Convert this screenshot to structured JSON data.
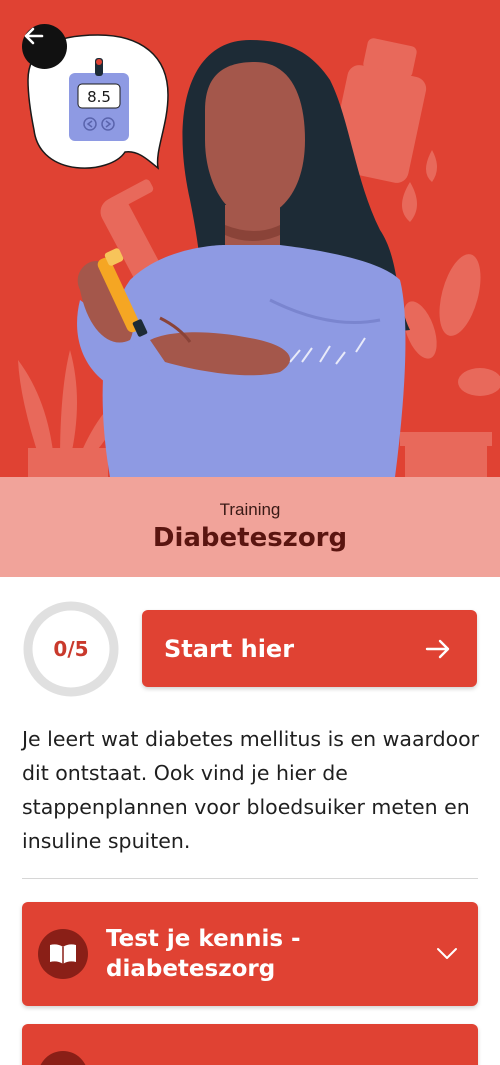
{
  "hero": {
    "glucose_reading": "8.5"
  },
  "header": {
    "kicker": "Training",
    "title": "Diabeteszorg"
  },
  "progress": {
    "completed": 0,
    "total": 5,
    "label": "0/5"
  },
  "start_button": {
    "label": "Start hier"
  },
  "description": "Je leert wat diabetes mellitus is en waardoor dit ontstaat. Ook vind je hier de stappenplannen voor bloedsuiker meten en insuline spuiten.",
  "modules": [
    {
      "title": "Test je kennis - diabeteszorg",
      "icon": "book-icon"
    },
    {
      "title": "",
      "icon": "book-icon"
    }
  ],
  "colors": {
    "accent": "#e04233",
    "accent_dark": "#8a1f17",
    "title_band": "#f1a39a",
    "title_text": "#5a1510",
    "ring_track": "#e0e0e0"
  },
  "icons": {
    "back": "arrow-left-icon",
    "start": "arrow-right-icon",
    "expand": "chevron-down-icon"
  }
}
